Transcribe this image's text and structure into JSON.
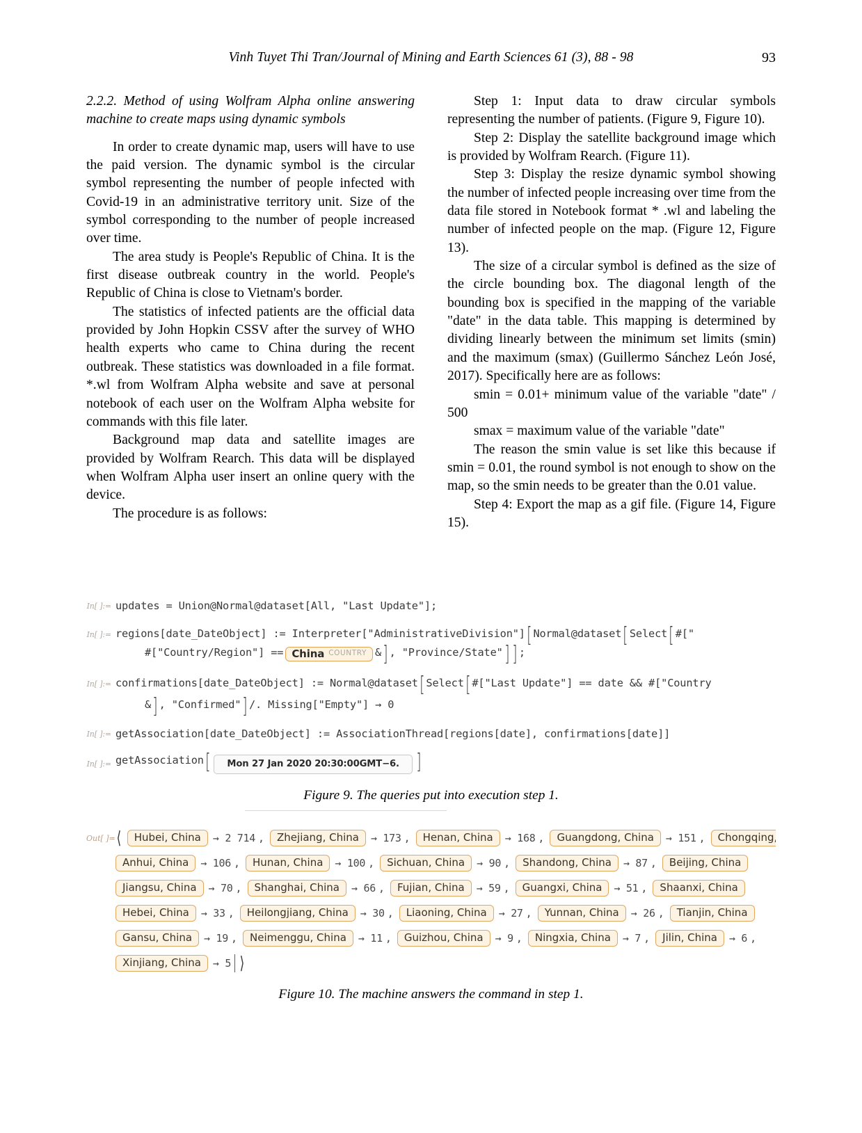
{
  "running_head": {
    "citation": "Vinh Tuyet Thi Tran/Journal of Mining and Earth Sciences 61 (3), 88 - 98",
    "page_number": "93"
  },
  "left_column": {
    "subheading": "2.2.2. Method of using Wolfram Alpha online answering machine to create maps using dynamic symbols",
    "paragraphs": [
      "In order to create dynamic map, users will have to use the paid version. The dynamic symbol is the circular symbol representing the number of people infected with Covid-19 in an administrative territory unit.  Size of the symbol corresponding to the number of people increased over time.",
      "The area study is People's Republic of China. It is the first disease outbreak country in the world. People's Republic of China is close to Vietnam's border.",
      "The statistics of infected patients are the official data provided by John Hopkin CSSV after the survey of WHO health experts who came to China during the recent outbreak. These statistics was downloaded in a file format. *.wl from Wolfram Alpha website and save at personal notebook of each user on the Wolfram Alpha website for commands with this file later.",
      "Background map data and satellite images are provided by Wolfram Rearch. This data will be displayed when Wolfram Alpha user insert an online query with the device.",
      "The procedure is as follows:"
    ]
  },
  "right_column": {
    "paragraphs": [
      "Step 1: Input data to draw circular symbols representing the number of patients. (Figure 9, Figure 10).",
      "Step 2: Display the satellite background image which is provided by Wolfram Rearch. (Figure 11).",
      "Step 3: Display the resize dynamic symbol showing the number of infected people increasing over time from the data file stored in Notebook format * .wl and labeling the number of infected people on the map. (Figure 12, Figure 13).",
      "The size of a circular symbol is defined as the size of the circle bounding box. The diagonal length of the bounding box is specified in the mapping of the variable \"date\" in the data table. This mapping is determined by dividing linearly between the minimum set limits (smin) and the maximum (smax) (Guillermo Sánchez León José, 2017). Specifically here are as follows:",
      "smin = 0.01+ minimum value of the variable \"date\" / 500",
      "smax = maximum value of the variable \"date\"",
      "The reason the smin value is set like this because if smin = 0.01, the round symbol is not enough to show on the map, so the smin needs to be greater than the 0.01 value.",
      "Step 4: Export the map as a gif file. (Figure 14, Figure 15)."
    ]
  },
  "figure9": {
    "caption": "Figure 9. The queries put into execution step 1.",
    "in_label": "In[ ]:=",
    "lines": {
      "line1": "updates = Union@Normal@dataset[All, \"Last Update\"];",
      "line2a": "regions[date_DateObject] := Interpreter[\"AdministrativeDivision\"]",
      "line2b": "Normal@dataset",
      "line2c": "Select",
      "line2d": "#[\"",
      "line3a": "#[\"Country/Region\"] ==",
      "line3b": "&",
      "line3c": ", \"Province/State\"",
      "line3d": ";",
      "line4a": "confirmations[date_DateObject] := Normal@dataset",
      "line4b": "Select",
      "line4c": "#[\"Last Update\"] == date && #[\"Country",
      "line5a": "&",
      "line5b": ", \"Confirmed\"",
      "line5c": "/. Missing[\"Empty\"] → 0",
      "line6": "getAssociation[date_DateObject] := AssociationThread[regions[date], confirmations[date]]",
      "line7a": "getAssociation",
      "line7b": "Mon 27 Jan 2020 20:30:00GMT−6."
    },
    "entity_china": {
      "name": "China",
      "type": "COUNTRY"
    }
  },
  "figure10": {
    "caption": "Figure 10. The machine answers the command in step 1.",
    "out_label": "Out[ ]=",
    "rows": [
      [
        {
          "entity": "Hubei, China",
          "value": "2 714"
        },
        {
          "entity": "Zhejiang, China",
          "value": "173"
        },
        {
          "entity": "Henan, China",
          "value": "168"
        },
        {
          "entity": "Guangdong, China",
          "value": "151"
        },
        {
          "entity": "Chongqing, China",
          "value": ""
        }
      ],
      [
        {
          "entity": "Anhui, China",
          "value": "106"
        },
        {
          "entity": "Hunan, China",
          "value": "100"
        },
        {
          "entity": "Sichuan, China",
          "value": "90"
        },
        {
          "entity": "Shandong, China",
          "value": "87"
        },
        {
          "entity": "Beijing, China",
          "value": ""
        }
      ],
      [
        {
          "entity": "Jiangsu, China",
          "value": "70"
        },
        {
          "entity": "Shanghai, China",
          "value": "66"
        },
        {
          "entity": "Fujian, China",
          "value": "59"
        },
        {
          "entity": "Guangxi, China",
          "value": "51"
        },
        {
          "entity": "Shaanxi, China",
          "value": ""
        }
      ],
      [
        {
          "entity": "Hebei, China",
          "value": "33"
        },
        {
          "entity": "Heilongjiang, China",
          "value": "30"
        },
        {
          "entity": "Liaoning, China",
          "value": "27"
        },
        {
          "entity": "Yunnan, China",
          "value": "26"
        },
        {
          "entity": "Tianjin, China",
          "value": ""
        }
      ],
      [
        {
          "entity": "Gansu, China",
          "value": "19"
        },
        {
          "entity": "Neimenggu, China",
          "value": "11"
        },
        {
          "entity": "Guizhou, China",
          "value": "9"
        },
        {
          "entity": "Ningxia, China",
          "value": "7"
        },
        {
          "entity": "Jilin, China",
          "value": "6"
        }
      ],
      [
        {
          "entity": "Xinjiang, China",
          "value": "5"
        }
      ]
    ]
  },
  "colors": {
    "entity_border": "#e0a860",
    "entity_fill": "#fdf3e2",
    "code_text": "#3a3a3a",
    "label_grey": "#b0a8a0"
  }
}
